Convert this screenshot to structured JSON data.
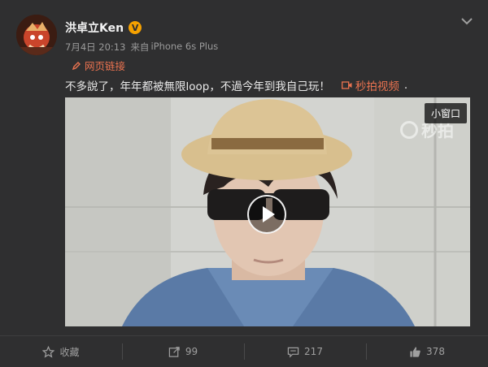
{
  "post": {
    "username": "洪卓立Ken",
    "verified_badge": "V",
    "date": "7月4日 20:13",
    "source_prefix": "来自",
    "source_device": "iPhone 6s Plus",
    "web_link_label": "网页链接",
    "text": "不多說了，年年都被無限loop，不過今年到我自己玩！",
    "video_link_label": "秒拍视频",
    "trailing_dot": "."
  },
  "video": {
    "mini_window_label": "小窗口",
    "watermark_text": "秒拍"
  },
  "actions": [
    {
      "label": "收藏",
      "icon": "star-icon"
    },
    {
      "label": "99",
      "icon": "share-icon"
    },
    {
      "label": "217",
      "icon": "comment-icon"
    },
    {
      "label": "378",
      "icon": "like-icon"
    }
  ],
  "colors": {
    "background": "#2f2f30",
    "link": "#eb7350",
    "verified": "#f5a100",
    "muted": "#9a9a9a"
  }
}
